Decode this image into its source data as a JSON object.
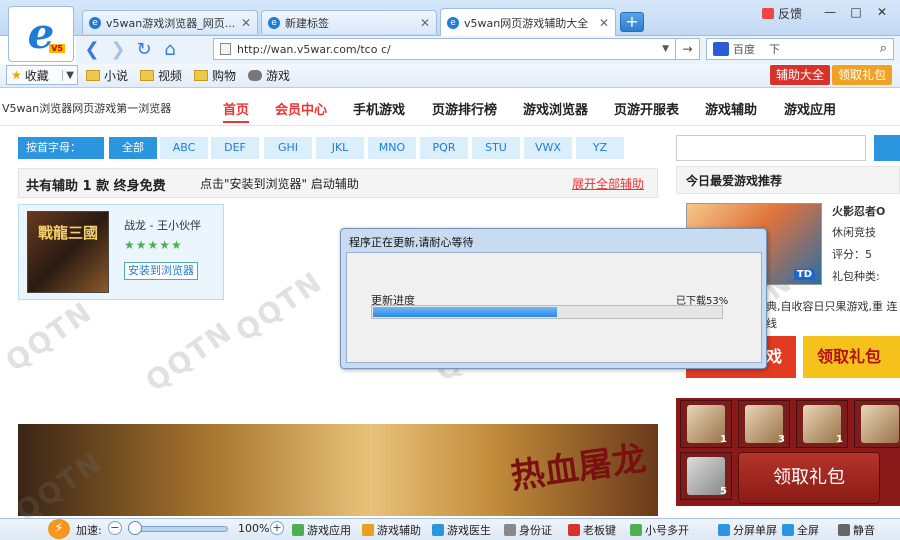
{
  "browser": {
    "tabs": [
      {
        "label": "v5wan游戏浏览器_网页..."
      },
      {
        "label": "新建标签"
      },
      {
        "label": "v5wan网页游戏辅助大全"
      }
    ],
    "new_tab": "+",
    "feedback": "反馈",
    "window_controls": {
      "min": "—",
      "max": "□",
      "close": "✕"
    },
    "address": "http://wan.v5war.com/tco c/",
    "go": "→",
    "search_engine": "百度",
    "search_placeholder": "下",
    "favorites_label": "收藏",
    "favorites": [
      "小说",
      "视频",
      "购物",
      "游戏"
    ],
    "fav_buttons": [
      "辅助大全",
      "领取礼包"
    ]
  },
  "site": {
    "title": "V5wan浏览器网页游戏第一浏览器",
    "nav": [
      "首页",
      "会员中心",
      "手机游戏",
      "页游排行榜",
      "游戏浏览器",
      "页游开服表",
      "游戏辅助",
      "游戏应用"
    ],
    "filter_label": "按首字母：",
    "filters": [
      "全部",
      "ABC",
      "DEF",
      "GHI",
      "JKL",
      "MNO",
      "PQR",
      "STU",
      "VWX",
      "YZ"
    ],
    "info_count": "共有辅助 1 款 终身免费",
    "info_hint": "点击\"安装到浏览器\" 启动辅助",
    "info_link": "展开全部辅助",
    "game": {
      "image_text": "戰龍三國",
      "name": "战龙 - 王小伙伴",
      "stars": "★★★★★",
      "install": "安装到浏览器"
    },
    "banner_title": "热血屠龙"
  },
  "right": {
    "header": "今日最爱游戏推荐",
    "game_name": "火影忍者O",
    "game_type": "休闲竞技",
    "score": "评分：5",
    "gift_type": "礼包种类:",
    "image_tag": "TD",
    "desc": "典,自收容日只果游戏,重 连线",
    "btn_play": "戏",
    "btn_gift": "领取礼包",
    "slots": [
      "1",
      "3",
      "1",
      "",
      "",
      "5"
    ],
    "gift_big": "领取礼包"
  },
  "dialog": {
    "title": "程序正在更新,请耐心等待",
    "label": "更新进度",
    "percent_text": "已下载53%",
    "progress": 0.53
  },
  "status": {
    "accel": "加速:",
    "minus": "−",
    "plus": "+",
    "zoom": "100%",
    "items": [
      "游戏应用",
      "游戏辅助",
      "游戏医生",
      "身份证",
      "老板键",
      "小号多开",
      "分屏单屏",
      "全屏",
      "静音"
    ]
  },
  "colors": {
    "accent": "#2c95e0",
    "red": "#e33333"
  }
}
